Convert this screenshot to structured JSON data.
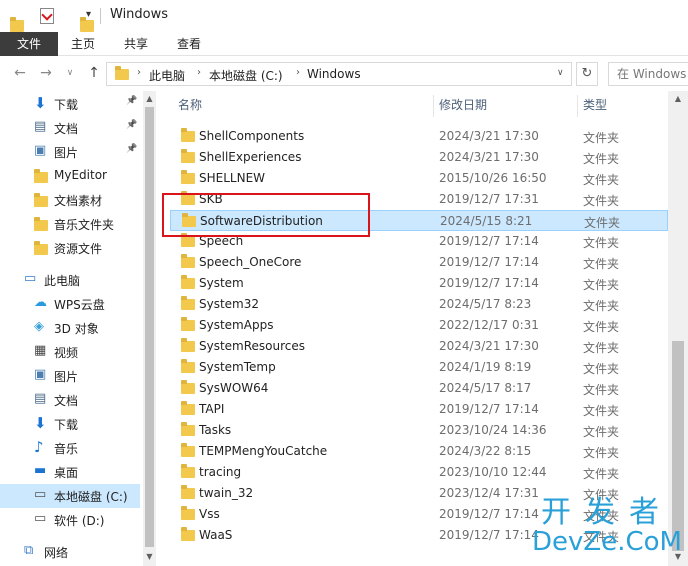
{
  "window": {
    "title": "Windows"
  },
  "ribbon": {
    "tabs": [
      "文件",
      "主页",
      "共享",
      "查看"
    ]
  },
  "address": {
    "crumbs": [
      "此电脑",
      "本地磁盘 (C:)",
      "Windows"
    ],
    "search_placeholder": "在 Windows 中搜索"
  },
  "nav": {
    "items": [
      {
        "label": "下载",
        "icon": "download-icon",
        "pinned": true
      },
      {
        "label": "文档",
        "icon": "document-icon",
        "pinned": true
      },
      {
        "label": "图片",
        "icon": "picture-icon",
        "pinned": true
      },
      {
        "label": "MyEditor",
        "icon": "folder-icon",
        "pinned": false
      },
      {
        "label": "文档素材",
        "icon": "folder-icon",
        "pinned": false
      },
      {
        "label": "音乐文件夹",
        "icon": "folder-icon",
        "pinned": false
      },
      {
        "label": "资源文件",
        "icon": "folder-icon",
        "pinned": false
      },
      {
        "label": "此电脑",
        "icon": "computer-icon",
        "pinned": false
      },
      {
        "label": "WPS云盘",
        "icon": "cloud-icon",
        "pinned": false
      },
      {
        "label": "3D 对象",
        "icon": "3d-objects-icon",
        "pinned": false
      },
      {
        "label": "视频",
        "icon": "video-icon",
        "pinned": false
      },
      {
        "label": "图片",
        "icon": "picture-icon",
        "pinned": false
      },
      {
        "label": "文档",
        "icon": "document-icon",
        "pinned": false
      },
      {
        "label": "下载",
        "icon": "download-icon",
        "pinned": false
      },
      {
        "label": "音乐",
        "icon": "music-icon",
        "pinned": false
      },
      {
        "label": "桌面",
        "icon": "desktop-icon",
        "pinned": false
      },
      {
        "label": "本地磁盘 (C:)",
        "icon": "drive-icon",
        "pinned": false,
        "selected": true
      },
      {
        "label": "软件 (D:)",
        "icon": "drive-icon",
        "pinned": false
      },
      {
        "label": "网络",
        "icon": "network-icon",
        "pinned": false
      }
    ]
  },
  "list": {
    "columns": {
      "name": "名称",
      "date": "修改日期",
      "type": "类型"
    },
    "rows": [
      {
        "name": "ShellComponents",
        "date": "2024/3/21 17:30",
        "type": "文件夹"
      },
      {
        "name": "ShellExperiences",
        "date": "2024/3/21 17:30",
        "type": "文件夹"
      },
      {
        "name": "SHELLNEW",
        "date": "2015/10/26 16:50",
        "type": "文件夹"
      },
      {
        "name": "SKB",
        "date": "2019/12/7 17:31",
        "type": "文件夹"
      },
      {
        "name": "SoftwareDistribution",
        "date": "2024/5/15 8:21",
        "type": "文件夹",
        "selected": true
      },
      {
        "name": "Speech",
        "date": "2019/12/7 17:14",
        "type": "文件夹"
      },
      {
        "name": "Speech_OneCore",
        "date": "2019/12/7 17:14",
        "type": "文件夹"
      },
      {
        "name": "System",
        "date": "2019/12/7 17:14",
        "type": "文件夹"
      },
      {
        "name": "System32",
        "date": "2024/5/17 8:23",
        "type": "文件夹"
      },
      {
        "name": "SystemApps",
        "date": "2022/12/17 0:31",
        "type": "文件夹"
      },
      {
        "name": "SystemResources",
        "date": "2024/3/21 17:30",
        "type": "文件夹"
      },
      {
        "name": "SystemTemp",
        "date": "2024/1/19 8:19",
        "type": "文件夹"
      },
      {
        "name": "SysWOW64",
        "date": "2024/5/17 8:17",
        "type": "文件夹"
      },
      {
        "name": "TAPI",
        "date": "2019/12/7 17:14",
        "type": "文件夹"
      },
      {
        "name": "Tasks",
        "date": "2023/10/24 14:36",
        "type": "文件夹"
      },
      {
        "name": "TEMPMengYouCatche",
        "date": "2024/3/22 8:15",
        "type": "文件夹"
      },
      {
        "name": "tracing",
        "date": "2023/10/10 12:44",
        "type": "文件夹"
      },
      {
        "name": "twain_32",
        "date": "2023/12/4 17:31",
        "type": "文件夹"
      },
      {
        "name": "Vss",
        "date": "2019/12/7 17:14",
        "type": "文件夹"
      },
      {
        "name": "WaaS",
        "date": "2019/12/7 17:14",
        "type": "文件夹"
      }
    ]
  },
  "watermark": {
    "line1": "开发者",
    "line2": "DevZe.CoM"
  },
  "colors": {
    "selection": "#cce8ff",
    "highlight": "#d9151b",
    "folder": "#f2c94c"
  }
}
